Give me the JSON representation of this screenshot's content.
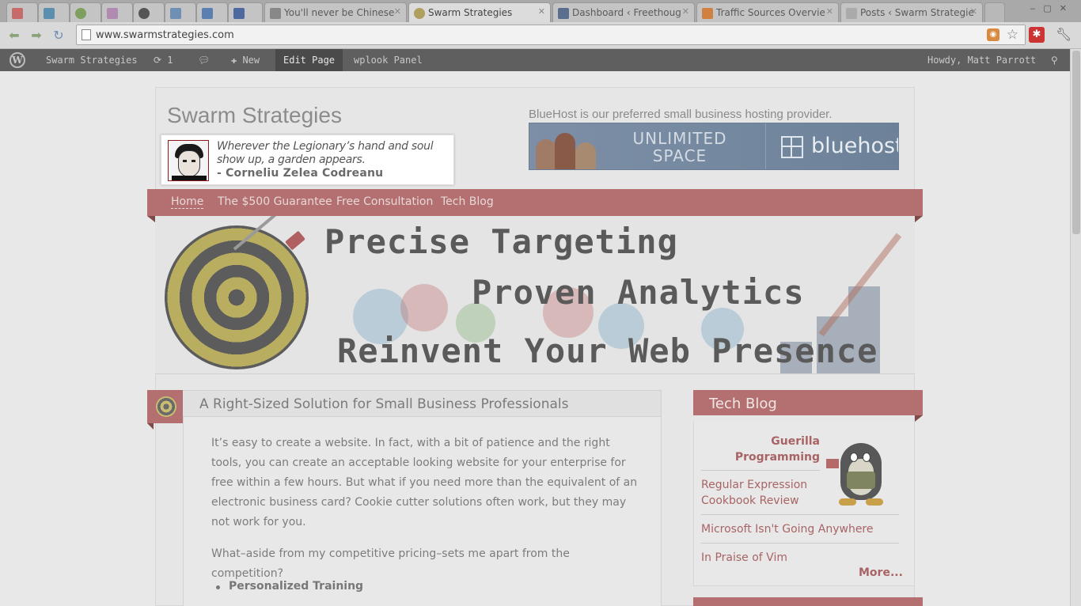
{
  "browser": {
    "tabs": [
      {
        "title": "",
        "icon_color": "#c66a6a"
      },
      {
        "title": "",
        "icon_color": "#5b8fb0"
      },
      {
        "title": "",
        "icon_color": "#7f9f5f"
      },
      {
        "title": "",
        "icon_color": "#b08ab0"
      },
      {
        "title": "",
        "icon_color": "#555555"
      },
      {
        "title": "",
        "icon_color": "#6f8fb5"
      },
      {
        "title": "",
        "icon_color": "#5b7fb0"
      },
      {
        "title": "",
        "icon_color": "#4e68a0"
      },
      {
        "title": "You'll never be Chinese",
        "icon_color": "#888888"
      },
      {
        "title": "Swarm Strategies",
        "icon_color": "#b0a060"
      },
      {
        "title": "Dashboard ‹ Freethoug",
        "icon_color": "#5a6e90"
      },
      {
        "title": "Traffic Sources Overvie",
        "icon_color": "#d08040"
      },
      {
        "title": "Posts ‹ Swarm Strategie",
        "icon_color": "#aaaaaa"
      }
    ],
    "url": "www.swarmstrategies.com",
    "rss_label": "RSS",
    "ext_label": "✱"
  },
  "adminbar": {
    "logo": "W",
    "site": "Swarm Strategies",
    "updates_count": "1",
    "new_label": "New",
    "edit_page": "Edit Page",
    "panel": "wplook Panel",
    "howdy": "Howdy, Matt Parrott"
  },
  "header": {
    "site_title": "Swarm Strategies",
    "host_caption": "BlueHost is our preferred small business hosting provider.",
    "banner_line1": "UNLIMITED",
    "banner_line2": "SPACE",
    "banner_brand": "bluehost"
  },
  "quote": {
    "text": "Wherever the Legionary’s hand and soul show up, a garden appears.",
    "author": "- Corneliu Zelea Codreanu"
  },
  "menu": {
    "items": [
      "Home",
      "The $500 Guarantee",
      "Free Consultation",
      "Tech Blog"
    ]
  },
  "hero": {
    "line1": "Precise Targeting",
    "line2": "Proven Analytics",
    "line3": "Reinvent Your Web Presence"
  },
  "post": {
    "title": "A Right-Sized Solution for Small Business Professionals",
    "para1": "It’s easy to create a website. In fact, with a bit of patience and the right tools, you can create an acceptable looking website for your enterprise for free within a few hours. But what if you need more than the equivalent of an electronic business card? Cookie cutter solutions often work, but they may not work for you.",
    "para2": "What–aside from my competitive pricing–sets me apart from the competition?",
    "bullet1": "Personalized Training"
  },
  "sidebar": {
    "title": "Tech Blog",
    "featured": "Guerilla Programming",
    "links": [
      "Regular Expression Cookbook Review",
      "Microsoft Isn't Going Anywhere",
      "In Praise of Vim"
    ],
    "more": "More..."
  }
}
